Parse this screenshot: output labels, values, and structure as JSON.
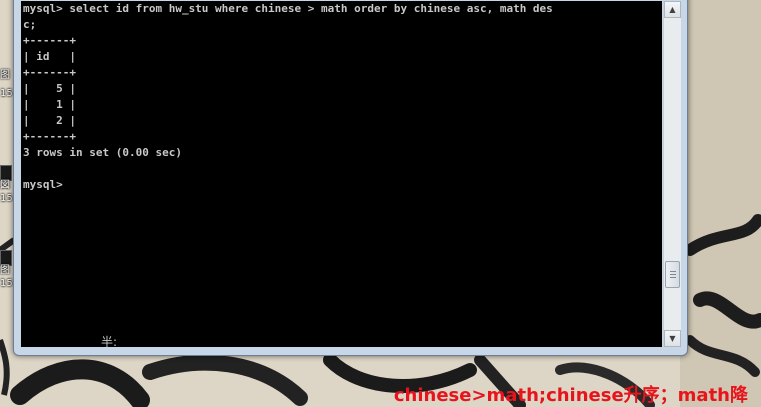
{
  "console": {
    "lines": [
      "mysql> select id from hw_stu where chinese > math order by chinese asc, math des",
      "c;",
      "+------+",
      "| id   |",
      "+------+",
      "|    5 |",
      "|    1 |",
      "|    2 |",
      "+------+",
      "3 rows in set (0.00 sec)",
      "",
      "mysql>"
    ],
    "ime_status": "半:"
  },
  "desktop_icons": [
    {
      "label": "图"
    },
    {
      "label": "15"
    },
    {
      "label": "図"
    },
    {
      "label": "15"
    },
    {
      "label": "图"
    },
    {
      "label": "15"
    }
  ],
  "scrollbar": {
    "up_icon": "arrow-up-icon",
    "down_icon": "arrow-down-icon"
  },
  "caption": {
    "text": "chinese>math;chinese升序；math降",
    "color": "#e8141c"
  },
  "colors": {
    "console_bg": "#000000",
    "console_fg": "#c8c8c8",
    "window_frame": "#c7d7e8"
  }
}
